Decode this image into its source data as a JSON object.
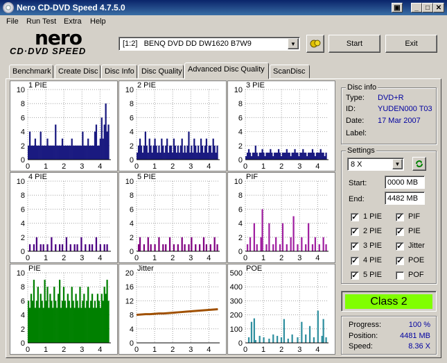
{
  "window": {
    "title": "Nero CD-DVD Speed 4.7.5.0",
    "controls": [
      "▣",
      "_",
      "✕"
    ]
  },
  "menu": [
    "File",
    "Run Test",
    "Extra",
    "Help"
  ],
  "logo": {
    "line1": "nero",
    "line2": "CD·DVD SPEED"
  },
  "drive": {
    "selected": "[1:2]   BENQ DVD DD DW1620 B7W9"
  },
  "toolbar": {
    "start": "Start",
    "exit": "Exit"
  },
  "tabs": [
    "Benchmark",
    "Create Disc",
    "Disc Info",
    "Disc Quality",
    "Advanced Disc Quality",
    "ScanDisc"
  ],
  "active_tab": "Advanced Disc Quality",
  "disc_info": {
    "title": "Disc info",
    "rows": [
      {
        "label": "Type:",
        "value": "DVD+R"
      },
      {
        "label": "ID:",
        "value": "YUDEN000 T03"
      },
      {
        "label": "Date:",
        "value": "17 Mar 2007"
      },
      {
        "label": "Label:",
        "value": ""
      }
    ]
  },
  "settings": {
    "title": "Settings",
    "speed": "8 X",
    "start_label": "Start:",
    "start_value": "0000 MB",
    "end_label": "End:",
    "end_value": "4482 MB",
    "checks_left": [
      {
        "label": "1 PIE",
        "checked": true
      },
      {
        "label": "2 PIE",
        "checked": true
      },
      {
        "label": "3 PIE",
        "checked": true
      },
      {
        "label": "4 PIE",
        "checked": true
      },
      {
        "label": "5 PIE",
        "checked": true
      }
    ],
    "checks_right": [
      {
        "label": "PIF",
        "checked": true
      },
      {
        "label": "PIE",
        "checked": true
      },
      {
        "label": "Jitter",
        "checked": true
      },
      {
        "label": "POE",
        "checked": true
      },
      {
        "label": "POF",
        "checked": false
      }
    ]
  },
  "class": {
    "text": "Class 2",
    "color": "#80ff00"
  },
  "status": {
    "progress_label": "Progress:",
    "progress_value": "100 %",
    "position_label": "Position:",
    "position_value": "4481 MB",
    "speed_label": "Speed:",
    "speed_value": "8.36 X"
  },
  "chart_data": [
    {
      "type": "bar",
      "title": "1 PIE",
      "color": "#1a1a80",
      "ylim": [
        0,
        10
      ],
      "yticks": [
        0,
        2,
        4,
        6,
        8,
        10
      ],
      "xticks": [
        0,
        1,
        2,
        3,
        4
      ],
      "values": [
        2,
        4,
        2,
        2,
        2,
        3,
        2,
        2,
        2,
        4,
        2,
        2,
        2,
        2,
        3,
        2,
        2,
        2,
        2,
        2,
        5,
        2,
        2,
        2,
        2,
        3,
        2,
        2,
        2,
        2,
        2,
        2,
        3,
        2,
        2,
        2,
        2,
        2,
        2,
        2,
        4,
        2,
        2,
        2,
        3,
        2,
        2,
        2,
        2,
        4,
        5,
        2,
        2,
        3,
        6,
        3,
        5,
        8,
        4,
        5
      ]
    },
    {
      "type": "bar",
      "title": "2 PIE",
      "color": "#1a1a80",
      "ylim": [
        0,
        10
      ],
      "yticks": [
        0,
        2,
        4,
        6,
        8,
        10
      ],
      "xticks": [
        0,
        1,
        2,
        3,
        4
      ],
      "values": [
        1,
        2,
        3,
        2,
        1,
        2,
        4,
        2,
        1,
        3,
        2,
        1,
        2,
        3,
        2,
        1,
        2,
        1,
        3,
        2,
        1,
        2,
        3,
        1,
        2,
        2,
        1,
        3,
        2,
        1,
        2,
        1,
        2,
        3,
        1,
        2,
        1,
        2,
        4,
        1,
        2,
        1,
        3,
        2,
        1,
        2,
        1,
        3,
        2,
        1,
        2,
        3,
        1,
        2,
        2,
        1,
        3,
        2,
        1,
        2
      ]
    },
    {
      "type": "bar",
      "title": "3 PIE",
      "color": "#1a1a80",
      "ylim": [
        0,
        10
      ],
      "yticks": [
        0,
        2,
        4,
        6,
        8,
        10
      ],
      "xticks": [
        0,
        1,
        2,
        3,
        4
      ],
      "values": [
        0.5,
        1,
        1.5,
        1,
        0.5,
        1,
        1,
        2,
        1,
        0.5,
        1,
        1,
        1.5,
        1,
        0.5,
        1,
        1,
        1,
        1.5,
        1,
        0.5,
        1,
        1,
        1,
        1.5,
        1,
        0.5,
        1,
        1,
        1,
        1.5,
        1,
        1,
        0.5,
        1,
        1,
        1.5,
        1,
        1,
        0.5,
        1,
        1,
        1.5,
        1,
        1,
        0.5,
        1,
        1,
        1,
        1.5,
        1,
        0.5,
        1,
        1,
        1,
        1.5,
        1,
        1,
        0.5,
        1
      ]
    },
    {
      "type": "bar",
      "title": "4 PIE",
      "color": "#4b0082",
      "ylim": [
        0,
        10
      ],
      "yticks": [
        0,
        2,
        4,
        6,
        8,
        10
      ],
      "xticks": [
        0,
        1,
        2,
        3,
        4
      ],
      "values": [
        0,
        1,
        0,
        0,
        1,
        0,
        2,
        0,
        0,
        1,
        0,
        1,
        0,
        0,
        1,
        0,
        0,
        2,
        0,
        0,
        1,
        0,
        0,
        1,
        0,
        1,
        0,
        0,
        2,
        0,
        0,
        1,
        0,
        0,
        1,
        0,
        1,
        0,
        0,
        2,
        0,
        0,
        1,
        0,
        0,
        1,
        0,
        1,
        0,
        0,
        2,
        0,
        0,
        1,
        0,
        0,
        1,
        0,
        1,
        0
      ]
    },
    {
      "type": "bar",
      "title": "5 PIE",
      "color": "#800080",
      "ylim": [
        0,
        10
      ],
      "yticks": [
        0,
        2,
        4,
        6,
        8,
        10
      ],
      "xticks": [
        0,
        1,
        2,
        3,
        4
      ],
      "values": [
        0,
        1,
        2,
        0,
        0,
        1,
        0,
        0,
        2,
        0,
        1,
        0,
        0,
        1,
        0,
        0,
        2,
        0,
        0,
        1,
        0,
        1,
        0,
        0,
        2,
        0,
        0,
        1,
        0,
        0,
        1,
        0,
        0,
        2,
        0,
        1,
        0,
        0,
        1,
        0,
        2,
        0,
        0,
        1,
        0,
        0,
        1,
        0,
        0,
        2,
        0,
        1,
        0,
        0,
        1,
        0,
        0,
        2,
        0,
        1
      ]
    },
    {
      "type": "bar",
      "title": "PIF",
      "color": "#a020a0",
      "ylim": [
        0,
        10
      ],
      "yticks": [
        0,
        2,
        4,
        6,
        8,
        10
      ],
      "xticks": [
        0,
        1,
        2,
        3,
        4
      ],
      "values": [
        0,
        1,
        0,
        2,
        0,
        0,
        4,
        0,
        1,
        0,
        0,
        2,
        6,
        0,
        0,
        1,
        0,
        4,
        0,
        0,
        1,
        0,
        2,
        0,
        0,
        1,
        0,
        4,
        0,
        0,
        1,
        0,
        0,
        2,
        0,
        5,
        0,
        0,
        1,
        0,
        0,
        2,
        0,
        0,
        1,
        0,
        4,
        0,
        0,
        1,
        0,
        2,
        0,
        0,
        1,
        0,
        0,
        2,
        0,
        1
      ]
    },
    {
      "type": "bar",
      "title": "PIE",
      "color": "#008000",
      "ylim": [
        0,
        10
      ],
      "yticks": [
        0,
        2,
        4,
        6,
        8,
        10
      ],
      "xticks": [
        0,
        1,
        2,
        3,
        4
      ],
      "values": [
        6,
        5,
        7,
        6,
        9,
        5,
        6,
        8,
        5,
        7,
        6,
        5,
        9,
        6,
        8,
        5,
        7,
        6,
        5,
        8,
        6,
        5,
        7,
        9,
        5,
        6,
        8,
        6,
        5,
        7,
        6,
        5,
        8,
        6,
        5,
        7,
        6,
        5,
        8,
        5,
        6,
        7,
        5,
        6,
        8,
        5,
        6,
        7,
        5,
        6,
        5,
        7,
        6,
        5,
        7,
        6,
        8,
        7,
        9,
        6
      ]
    },
    {
      "type": "line",
      "title": "Jitter",
      "color": "#a05000",
      "ylim": [
        0,
        20
      ],
      "yticks": [
        0,
        4,
        8,
        12,
        16,
        20
      ],
      "xticks": [
        0,
        1,
        2,
        3,
        4
      ],
      "x": [
        0,
        0.25,
        0.5,
        0.75,
        1,
        1.25,
        1.5,
        1.75,
        2,
        2.25,
        2.5,
        2.75,
        3,
        3.25,
        3.5,
        3.75,
        4,
        4.25,
        4.5
      ],
      "values": [
        8.0,
        8.1,
        8.2,
        8.2,
        8.3,
        8.4,
        8.4,
        8.5,
        8.6,
        8.7,
        8.8,
        8.9,
        9.0,
        9.1,
        9.2,
        9.3,
        9.4,
        9.5,
        9.6
      ]
    },
    {
      "type": "bar",
      "title": "POE",
      "color": "#3090a0",
      "ylim": [
        0,
        500
      ],
      "yticks": [
        0,
        100,
        200,
        300,
        400,
        500
      ],
      "xticks": [
        0,
        1,
        2,
        3,
        4
      ],
      "values": [
        0,
        0,
        40,
        0,
        150,
        0,
        175,
        20,
        0,
        0,
        50,
        0,
        0,
        40,
        0,
        0,
        0,
        30,
        0,
        0,
        60,
        0,
        0,
        50,
        0,
        0,
        40,
        0,
        170,
        0,
        0,
        30,
        0,
        0,
        60,
        0,
        0,
        0,
        40,
        0,
        0,
        150,
        0,
        0,
        60,
        0,
        0,
        120,
        0,
        0,
        40,
        0,
        0,
        230,
        0,
        0,
        50,
        170,
        0,
        40
      ]
    }
  ]
}
